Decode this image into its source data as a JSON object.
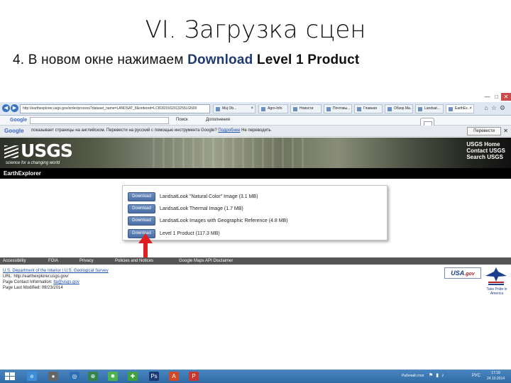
{
  "slide": {
    "title": "VI. Загрузка сцен",
    "subtitle_prefix": "4. В новом окне нажимаем ",
    "subtitle_highlight": "Download",
    "subtitle_suffix": " Level 1 Product"
  },
  "browser": {
    "address": "http://earthexplorer.usgs.gov/order/process?dataset_name=LANDSAT_8&ordered=LC81820162013255LGN00",
    "tabs": [
      {
        "label": "Muj Ob..."
      },
      {
        "label": "Agro-Info"
      },
      {
        "label": "Новости"
      },
      {
        "label": "Почтовы..."
      },
      {
        "label": "Главная"
      },
      {
        "label": "Обзор Ма..."
      },
      {
        "label": "Landsat..."
      },
      {
        "label": "EarthEx..."
      }
    ],
    "colors": {
      "tab_bar": "#dfe8f2",
      "close": "#c94b4b"
    }
  },
  "google_toolbar": {
    "logo": "Google",
    "items": [
      "Поиск",
      "Дополнения"
    ],
    "bar_logo": "Google",
    "translate_message": "показывает страницы на английском. Перевести на русский с помощью инструмента Google?",
    "translate_link": "Подробнее",
    "translate_option": "Не переводить",
    "translate_button": "Перевести"
  },
  "site": {
    "logo": "USGS",
    "tagline": "science for a changing world",
    "links": [
      "USGS Home",
      "Contact USGS",
      "Search USGS"
    ],
    "app_title": "EarthExplorer",
    "colors": {
      "button": "#4a6ea6",
      "footer": "#555555",
      "arrow": "#e02020"
    }
  },
  "download_options": [
    {
      "button": "Download",
      "label": "LandsatLook \"Natural Color\" Image (3.1 MB)"
    },
    {
      "button": "Download",
      "label": "LandsatLook Thermal Image (1.7 MB)"
    },
    {
      "button": "Download",
      "label": "LandsatLook Images with Geographic Reference (4.8 MB)"
    },
    {
      "button": "Download",
      "label": "Level 1 Product (117.3 MB)"
    }
  ],
  "footer": {
    "nav": [
      "Accessibility",
      "FOIA",
      "Privacy",
      "Policies and Notices",
      "Google Maps API Disclaimer"
    ],
    "department": "U.S. Department of the Interior | U.S. Geological Survey",
    "url_label": "URL:",
    "url": "http://earthexplorer.usgs.gov/",
    "contact_label": "Page Contact Information:",
    "contact": "lta@usgs.gov",
    "modified": "Page Last Modified: 09/23/2014",
    "usagov": "USA",
    "usagov_suffix": ".gov",
    "take_pride": "Take Pride in America"
  },
  "taskbar": {
    "tray_text": "Рабочий стол",
    "lang": "РУС",
    "time": "17:18",
    "date": "24.10.2014"
  }
}
